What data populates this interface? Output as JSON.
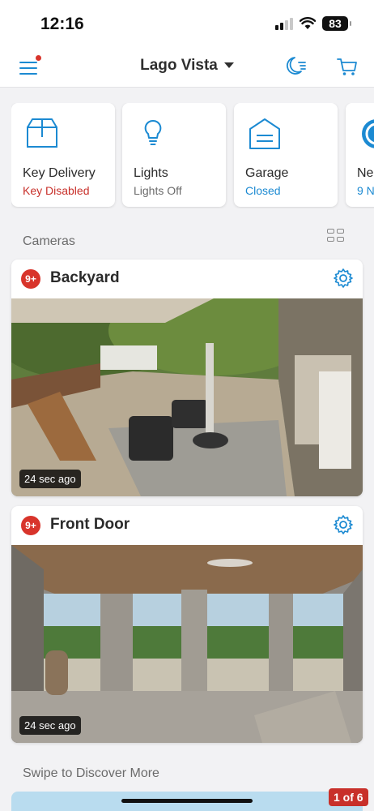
{
  "status_bar": {
    "time": "12:16",
    "battery": "83"
  },
  "header": {
    "location": "Lago Vista",
    "icons": [
      "menu-icon",
      "moon-mode-icon",
      "cart-icon"
    ],
    "notification_dot_color": "#d8342b",
    "accent_color": "#1c8ad2"
  },
  "devices": [
    {
      "name": "Key Delivery",
      "status": "Key Disabled",
      "status_color": "#c8302a",
      "icon": "package-icon"
    },
    {
      "name": "Lights",
      "status": "Lights Off",
      "status_color": "#6b6b6b",
      "icon": "lightbulb-icon"
    },
    {
      "name": "Garage",
      "status": "Closed",
      "status_color": "#1c8ad2",
      "icon": "garage-icon"
    },
    {
      "name": "Ne",
      "status": "9 N",
      "status_color": "#1c8ad2",
      "icon": "neighbors-icon"
    }
  ],
  "cameras_section": {
    "label": "Cameras"
  },
  "cameras": [
    {
      "name": "Backyard",
      "badge": "9+",
      "last_seen": "24 sec ago"
    },
    {
      "name": "Front Door",
      "badge": "9+",
      "last_seen": "24 sec ago"
    }
  ],
  "discover": {
    "label": "Swipe to Discover More",
    "page": "1 of 6"
  }
}
